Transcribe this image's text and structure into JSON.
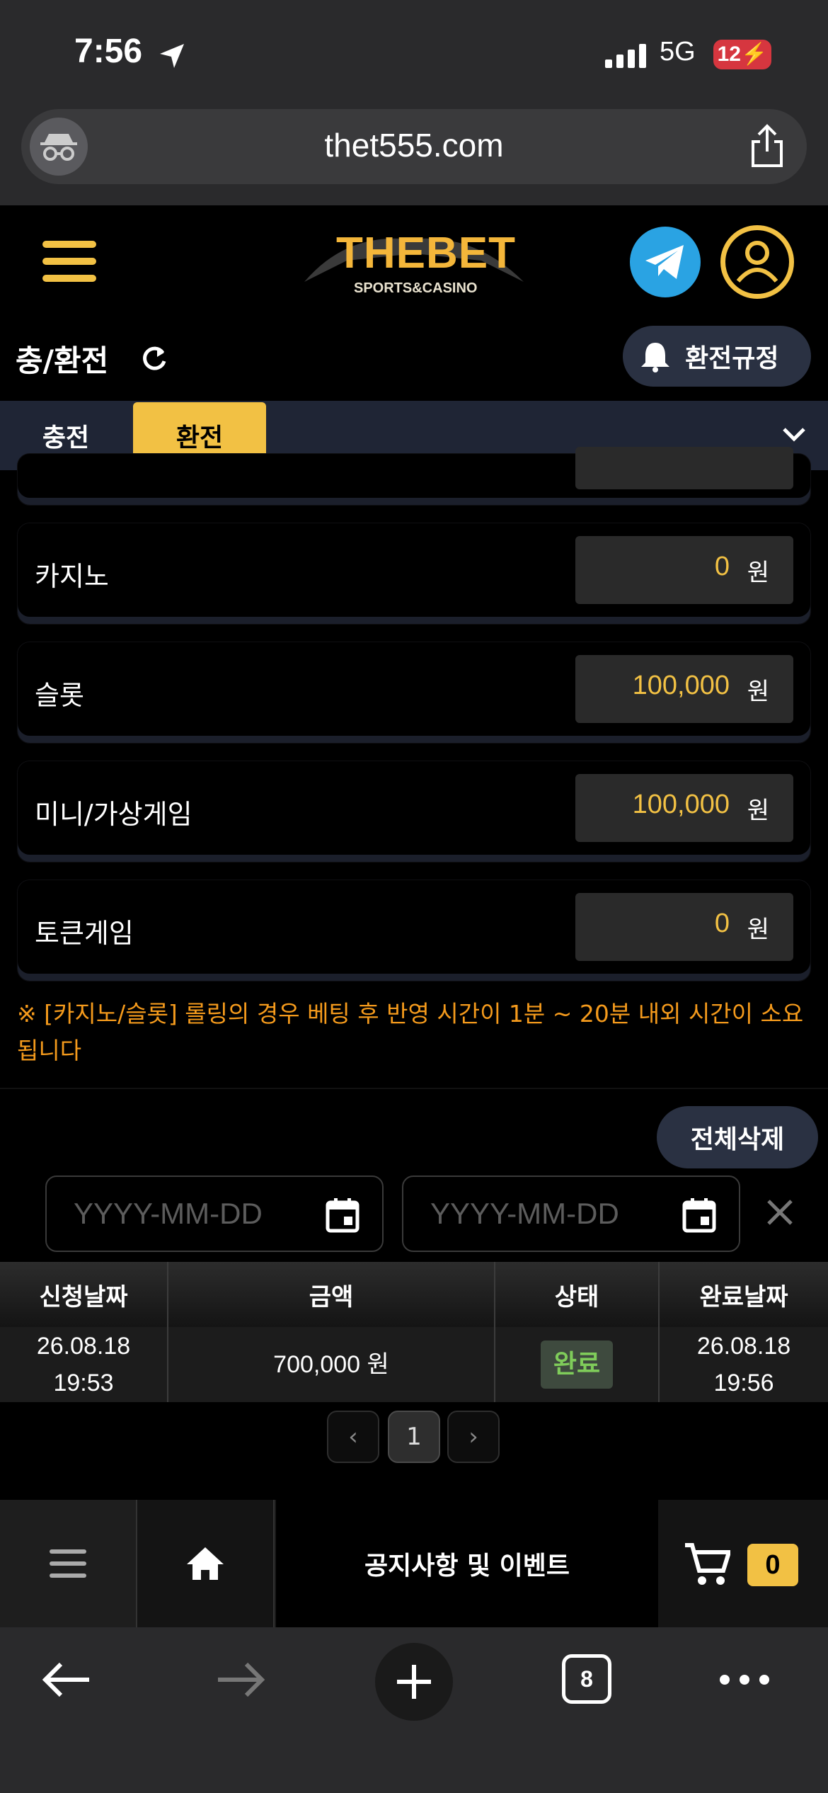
{
  "status": {
    "time": "7:56",
    "network": "5G",
    "battery": "12"
  },
  "browser": {
    "url": "thet555.com",
    "tab_count": "8"
  },
  "header": {
    "logo_text": "THEBET",
    "logo_subtext": "SPORTS&CASINO"
  },
  "page": {
    "title": "충/환전",
    "rules_button": "환전규정"
  },
  "tabs": [
    {
      "label": "충전",
      "active": false
    },
    {
      "label": "환전",
      "active": true
    }
  ],
  "balances": [
    {
      "label": "카지노",
      "value": "0",
      "unit": "원"
    },
    {
      "label": "슬롯",
      "value": "100,000",
      "unit": "원"
    },
    {
      "label": "미니/가상게임",
      "value": "100,000",
      "unit": "원"
    },
    {
      "label": "토큰게임",
      "value": "0",
      "unit": "원"
    }
  ],
  "note": "※ [카지노/슬롯] 롤링의 경우 베팅 후 반영 시간이 1분 ~ 20분 내외 시간이 소요됩니다",
  "history": {
    "delete_all": "전체삭제",
    "date_placeholder_from": "YYYY-MM-DD",
    "date_placeholder_to": "YYYY-MM-DD",
    "columns": [
      "신청날짜",
      "금액",
      "상태",
      "완료날짜"
    ],
    "rows": [
      {
        "request_date": "26.08.18",
        "request_time": "19:53",
        "amount": "700,000 원",
        "status": "완료",
        "done_date": "26.08.18",
        "done_time": "19:56"
      }
    ],
    "current_page": "1"
  },
  "bottom_nav": {
    "notice": "공지사항 및 이벤트",
    "cart_count": "0"
  },
  "colors": {
    "accent": "#f2c144",
    "warning": "#f49a1c",
    "status_done": "#7fcc5a"
  }
}
